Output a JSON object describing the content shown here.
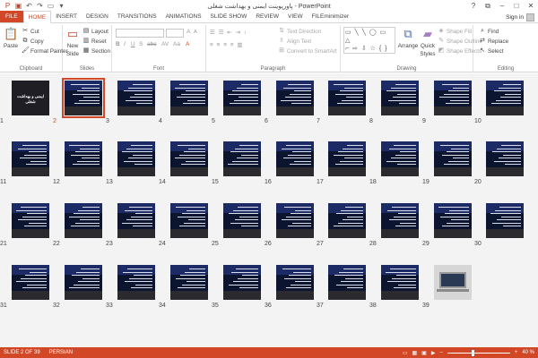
{
  "window": {
    "title": "پاورپوینت ایمنی و بهداشت شغلی  -  PowerPoint",
    "controls": [
      "?",
      "⧉",
      "–",
      "□",
      "✕"
    ]
  },
  "tabs": [
    "FILE",
    "HOME",
    "INSERT",
    "DESIGN",
    "TRANSITIONS",
    "ANIMATIONS",
    "SLIDE SHOW",
    "REVIEW",
    "VIEW",
    "FILEminimizer"
  ],
  "active_tab": "HOME",
  "signin": "Sign in",
  "ribbon": {
    "clipboard": {
      "paste": "Paste",
      "cut": "Cut",
      "copy": "Copy",
      "format_painter": "Format Painter",
      "label": "Clipboard"
    },
    "slides": {
      "new_slide_1": "New",
      "new_slide_2": "Slide",
      "layout": "Layout",
      "reset": "Reset",
      "section": "Section",
      "label": "Slides"
    },
    "font": {
      "label": "Font",
      "grow": "A",
      "shrink": "A",
      "clear": "A"
    },
    "paragraph": {
      "text_direction": "Text Direction",
      "align_text": "Align Text",
      "convert_smartart": "Convert to SmartArt",
      "label": "Paragraph"
    },
    "drawing": {
      "arrange": "Arrange",
      "quick_styles_1": "Quick",
      "quick_styles_2": "Styles",
      "shape_fill": "Shape Fill",
      "shape_outline": "Shape Outline",
      "shape_effects": "Shape Effects",
      "label": "Drawing"
    },
    "editing": {
      "find": "Find",
      "replace": "Replace",
      "select": "Select",
      "label": "Editing"
    }
  },
  "slides": {
    "count": 39,
    "selected": 2,
    "title_slide_text": "ایمنی و بهداشت شغلی",
    "numbers": [
      "1",
      "2",
      "3",
      "4",
      "5",
      "6",
      "7",
      "8",
      "9",
      "10",
      "11",
      "12",
      "13",
      "14",
      "15",
      "16",
      "17",
      "18",
      "19",
      "20",
      "21",
      "22",
      "23",
      "24",
      "25",
      "26",
      "27",
      "28",
      "29",
      "30",
      "31",
      "32",
      "33",
      "34",
      "35",
      "36",
      "37",
      "38",
      "39"
    ]
  },
  "status": {
    "slide_indicator": "SLIDE 2 OF 39",
    "language": "PERSIAN",
    "zoom": "40 %",
    "zoom_level": 0.4
  },
  "colors": {
    "accent": "#d24726",
    "slide_bg": "#0c1530"
  }
}
